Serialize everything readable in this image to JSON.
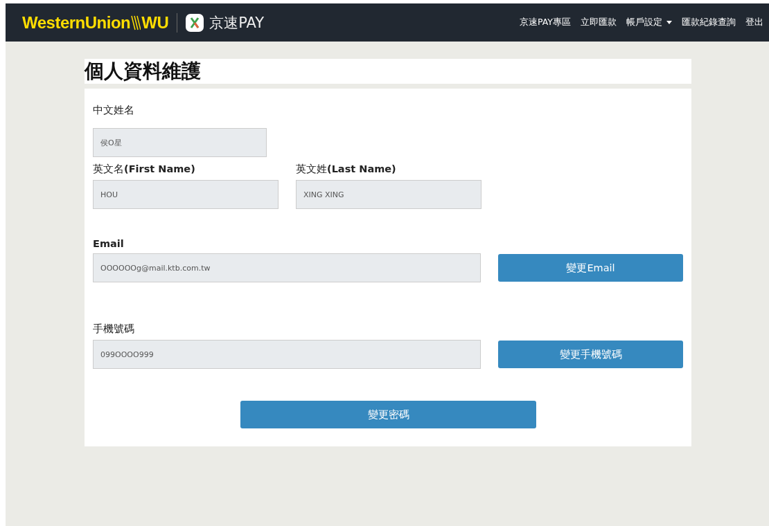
{
  "header": {
    "brand": {
      "name": "WesternUnion",
      "mark": "WU"
    },
    "partner": "京速PAY",
    "nav": [
      {
        "label": "京速PAY專區",
        "dropdown": false
      },
      {
        "label": "立即匯款",
        "dropdown": false
      },
      {
        "label": "帳戶設定",
        "dropdown": true
      },
      {
        "label": "匯款紀錄查詢",
        "dropdown": false
      },
      {
        "label": "登出",
        "dropdown": false
      }
    ]
  },
  "page_title": "個人資料維護",
  "form": {
    "chinese_name": {
      "label": "中文姓名",
      "bold": false,
      "value": "侯O星"
    },
    "first_name": {
      "label": "英文名**(First Name)**",
      "bold": false,
      "value": "HOU"
    },
    "last_name": {
      "label": "英文姓**(Last Name)**",
      "bold": false,
      "value": "XING XING"
    },
    "email": {
      "label": "Email",
      "bold": true,
      "value": "OOOOOOg@mail.ktb.com.tw",
      "button": "變更Email"
    },
    "mobile": {
      "label": "手機號碼",
      "bold": false,
      "value": "099OOOO999",
      "button": "變更手機號碼"
    },
    "password_button": "變更密碼"
  }
}
